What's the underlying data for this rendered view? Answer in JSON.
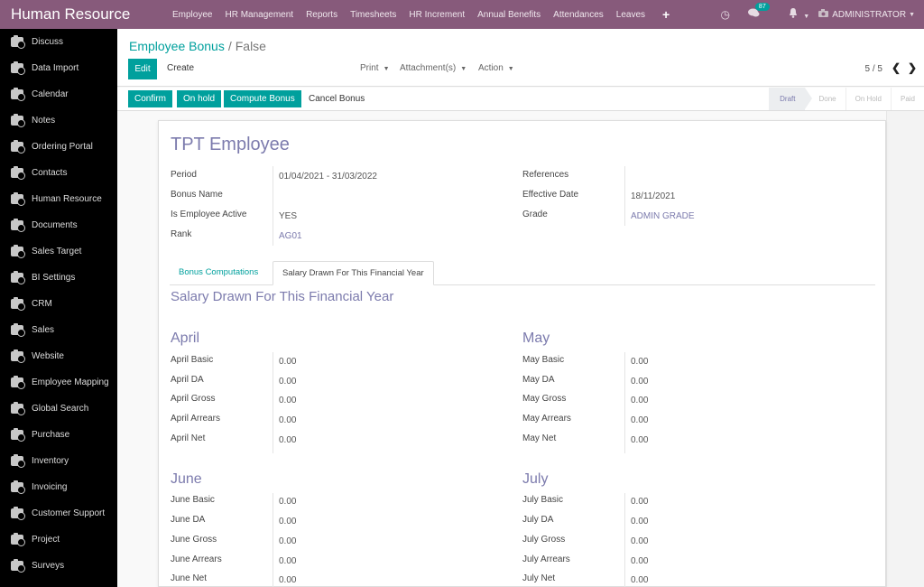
{
  "topbar": {
    "brand": "Human Resource",
    "menu": [
      "Employee",
      "HR Management",
      "Reports",
      "Timesheets",
      "HR Increment",
      "Annual Benefits",
      "Attendances",
      "Leaves"
    ],
    "plus_icon": "+",
    "clock_icon": "◷",
    "chat_icon": "💬",
    "chat_badge": "87",
    "bell_icon": "🔔",
    "user": "ADMINISTRATOR"
  },
  "sidebar": {
    "items": [
      "Discuss",
      "Data Import",
      "Calendar",
      "Notes",
      "Ordering Portal",
      "Contacts",
      "Human Resource",
      "Documents",
      "Sales Target",
      "BI Settings",
      "CRM",
      "Sales",
      "Website",
      "Employee Mapping",
      "Global Search",
      "Purchase",
      "Inventory",
      "Invoicing",
      "Customer Support",
      "Project",
      "Surveys"
    ]
  },
  "control_panel": {
    "breadcrumb_parent": "Employee Bonus",
    "breadcrumb_sep": "/",
    "breadcrumb_current": "False",
    "edit_label": "Edit",
    "create_label": "Create",
    "print_label": "Print",
    "attachment_label": "Attachment(s)",
    "action_label": "Action",
    "pager": "5 / 5",
    "prev_icon": "❮",
    "next_icon": "❯"
  },
  "statusbar": {
    "confirm_label": "Confirm",
    "onhold_label": "On hold",
    "compute_label": "Compute Bonus",
    "cancel_label": "Cancel Bonus",
    "stages": [
      "Draft",
      "Done",
      "On Hold",
      "Paid"
    ],
    "active_stage": "Draft"
  },
  "record": {
    "title": "TPT Employee",
    "left_fields": [
      {
        "label": "Period",
        "value": "01/04/2021 - 31/03/2022"
      },
      {
        "label": "Bonus Name",
        "value": ""
      },
      {
        "label": "Is Employee Active",
        "value": "YES"
      },
      {
        "label": "Rank",
        "value": "AG01"
      }
    ],
    "right_fields": [
      {
        "label": "References",
        "value": ""
      },
      {
        "label": "Effective Date",
        "value": "18/11/2021"
      },
      {
        "label": "Grade",
        "value": "ADMIN GRADE"
      }
    ],
    "tabs": [
      "Bonus Computations",
      "Salary Drawn For This Financial Year"
    ],
    "active_tab": "Salary Drawn For This Financial Year",
    "section_title": "Salary Drawn For This Financial Year",
    "months": [
      {
        "name": "April",
        "rows": [
          {
            "label": "April Basic",
            "value": "0.00"
          },
          {
            "label": "April DA",
            "value": "0.00"
          },
          {
            "label": "April Gross",
            "value": "0.00"
          },
          {
            "label": "April Arrears",
            "value": "0.00"
          },
          {
            "label": "April Net",
            "value": "0.00"
          }
        ]
      },
      {
        "name": "May",
        "rows": [
          {
            "label": "May Basic",
            "value": "0.00"
          },
          {
            "label": "May DA",
            "value": "0.00"
          },
          {
            "label": "May Gross",
            "value": "0.00"
          },
          {
            "label": "May Arrears",
            "value": "0.00"
          },
          {
            "label": "May Net",
            "value": "0.00"
          }
        ]
      },
      {
        "name": "June",
        "rows": [
          {
            "label": "June Basic",
            "value": "0.00"
          },
          {
            "label": "June DA",
            "value": "0.00"
          },
          {
            "label": "June Gross",
            "value": "0.00"
          },
          {
            "label": "June Arrears",
            "value": "0.00"
          },
          {
            "label": "June Net",
            "value": "0.00"
          }
        ]
      },
      {
        "name": "July",
        "rows": [
          {
            "label": "July Basic",
            "value": "0.00"
          },
          {
            "label": "July DA",
            "value": "0.00"
          },
          {
            "label": "July Gross",
            "value": "0.00"
          },
          {
            "label": "July Arrears",
            "value": "0.00"
          },
          {
            "label": "July Net",
            "value": "0.00"
          }
        ]
      }
    ]
  },
  "colors": {
    "brand": "#875a7b",
    "primary": "#00a09d",
    "accent": "#7c7bad"
  }
}
